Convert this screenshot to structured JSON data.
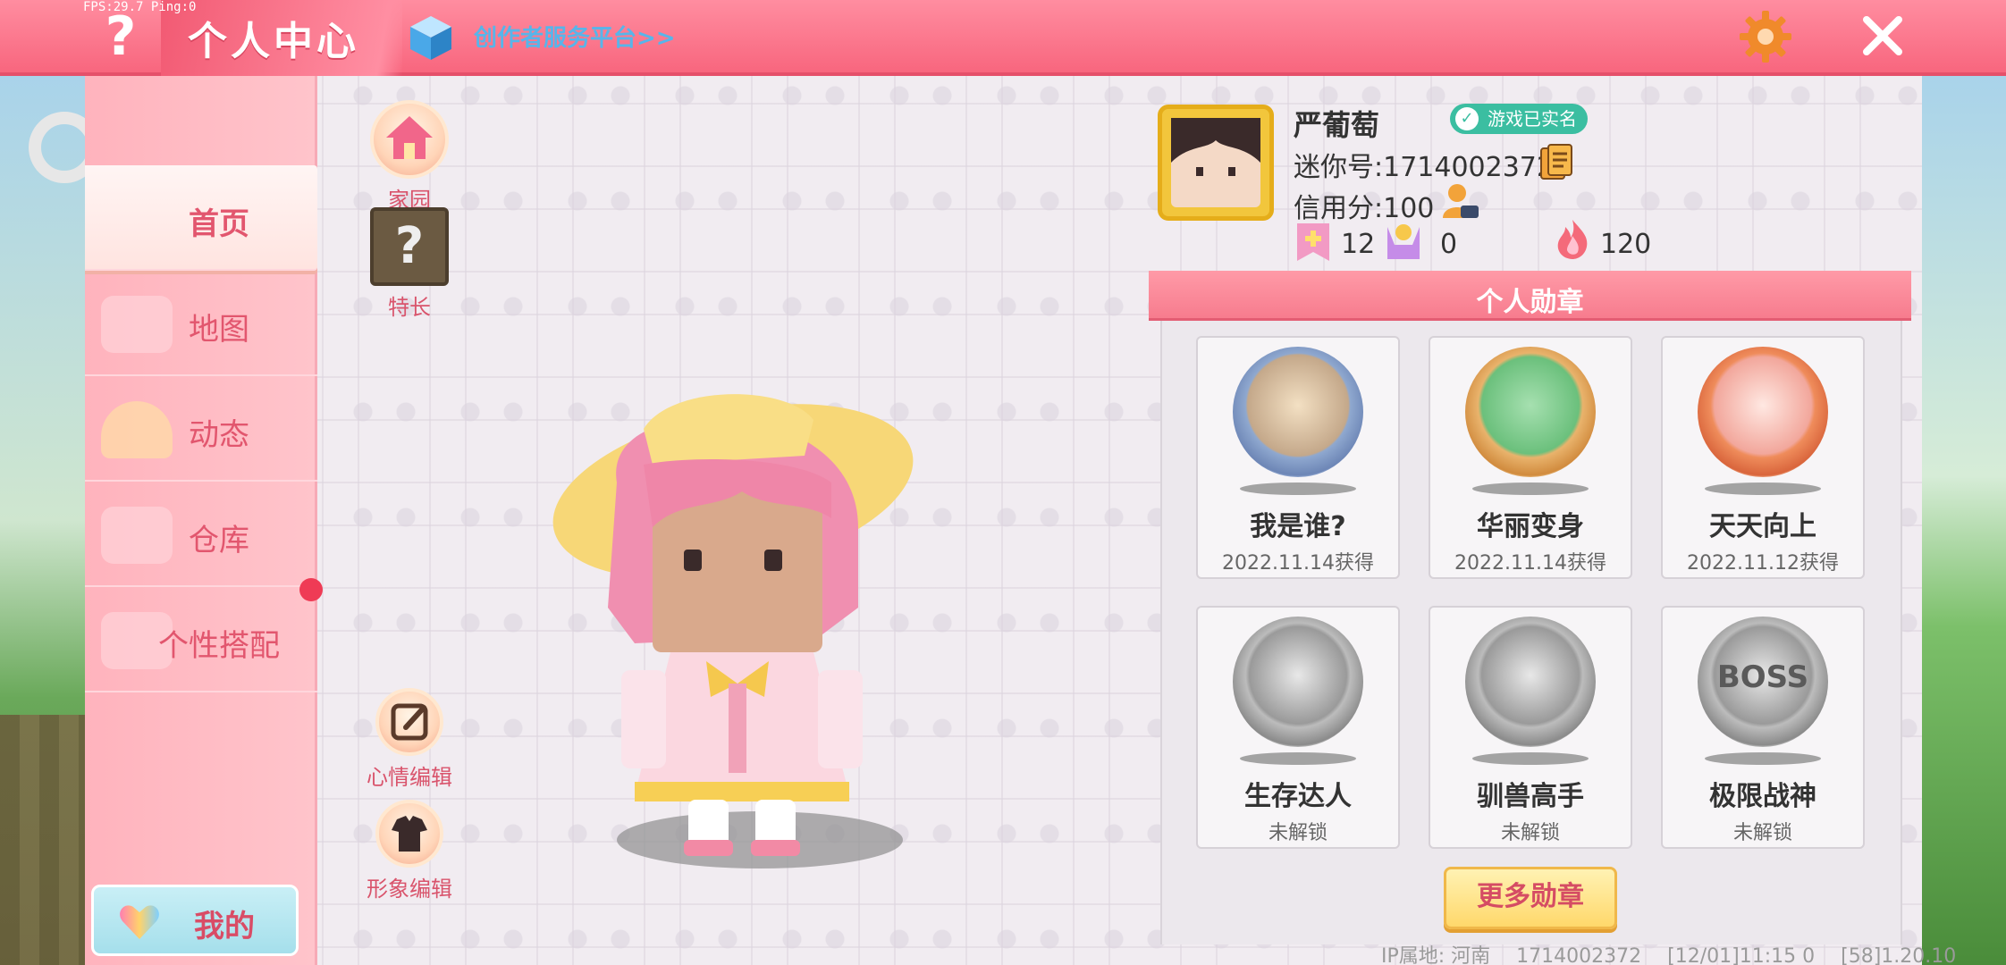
{
  "status": {
    "fps": "FPS:29.7  Ping:0"
  },
  "header": {
    "title": "个人中心",
    "creator_link": "创作者服务平台>>"
  },
  "sidebar": {
    "items": [
      {
        "label": "首页",
        "active": true
      },
      {
        "label": "地图"
      },
      {
        "label": "动态"
      },
      {
        "label": "仓库"
      },
      {
        "label": "个性搭配",
        "badge": true
      }
    ],
    "mine_label": "我的"
  },
  "tools": {
    "home": "家园",
    "skill": "特长",
    "mood": "心情编辑",
    "look": "形象编辑"
  },
  "profile": {
    "name": "严葡萄",
    "verified": "游戏已实名",
    "mini_id": "迷你号:1714002372",
    "credit": "信用分:100",
    "stats": [
      {
        "icon": "add-friend-icon",
        "value": "12"
      },
      {
        "icon": "fans-icon",
        "value": "0"
      },
      {
        "icon": "flame-icon",
        "value": "120"
      }
    ]
  },
  "medals": {
    "title": "个人勋章",
    "items": [
      {
        "title": "我是谁?",
        "sub": "2022.11.14获得",
        "color": "blue"
      },
      {
        "title": "华丽变身",
        "sub": "2022.11.14获得",
        "color": "gold"
      },
      {
        "title": "天天向上",
        "sub": "2022.11.12获得",
        "color": "orange"
      },
      {
        "title": "生存达人",
        "sub": "未解锁",
        "color": "gray"
      },
      {
        "title": "驯兽高手",
        "sub": "未解锁",
        "color": "gray"
      },
      {
        "title": "极限战神",
        "sub": "未解锁",
        "color": "gray",
        "glyph": "BOSS"
      }
    ],
    "more_label": "更多勋章"
  },
  "footer": {
    "ip": "IP属地: 河南",
    "uid": "1714002372",
    "time": "[12/01]11:15 0",
    "ver": "[58]1.20.10"
  },
  "colors": {
    "accent": "#f8667e",
    "sidebar": "#ffb3bd",
    "verified": "#3bbea1"
  }
}
